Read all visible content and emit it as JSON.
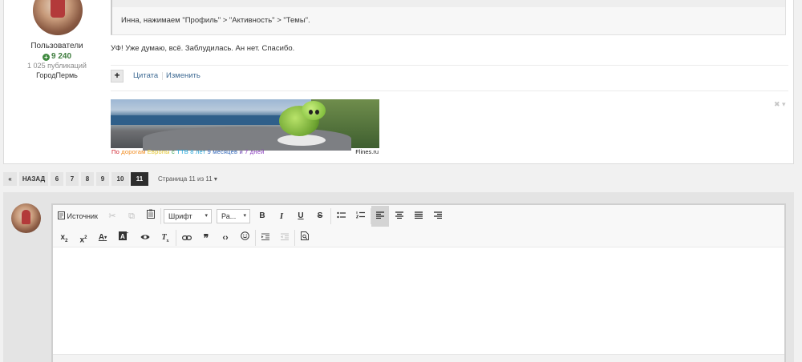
{
  "author": {
    "group": "Пользователи",
    "reputation": "9 240",
    "posts": "1 025 публикаций",
    "city": "ГородПермь"
  },
  "quote": {
    "text": "Инна,  нажимаем  \"Профиль\" > \"Активность\" > \"Темы\"."
  },
  "post": {
    "text": "УФ! Уже думаю, всё. Заблудилась. Ан нет. Спасибо.",
    "plus_label": "+",
    "quote_label": "Цитата",
    "edit_label": "Изменить"
  },
  "signature": {
    "caption_words": [
      {
        "text": "По ",
        "color": "#d0202a"
      },
      {
        "text": "дорогам ",
        "color": "#f08a1c"
      },
      {
        "text": "Европы ",
        "color": "#e3c52a"
      },
      {
        "text": "с ",
        "color": "#2ea046"
      },
      {
        "text": "ТТВ ",
        "color": "#1aa3d9"
      },
      {
        "text": "8 лет ",
        "color": "#2aa5d8"
      },
      {
        "text": "9 месяцев ",
        "color": "#2f64b8"
      },
      {
        "text": "и ",
        "color": "#6a3fb0"
      },
      {
        "text": "7 дней",
        "color": "#8a3bbf"
      }
    ],
    "site": "Flines.ru",
    "toggle": "✖ ▾"
  },
  "pagination": {
    "first_icon": "«",
    "prev_label": "НАЗАД",
    "pages": [
      "6",
      "7",
      "8",
      "9",
      "10",
      "11"
    ],
    "current": "11",
    "jump_label": "Страница 11 из 11",
    "jump_caret": "▾"
  },
  "editor": {
    "source_label": "Источник",
    "font_combo": "Шрифт",
    "size_combo": "Ра...",
    "combo_arrow": "▾"
  },
  "colors": {
    "accent_link": "#3e6a93",
    "active_page": "#2d2d2d",
    "reputation": "#3f7d3f"
  }
}
